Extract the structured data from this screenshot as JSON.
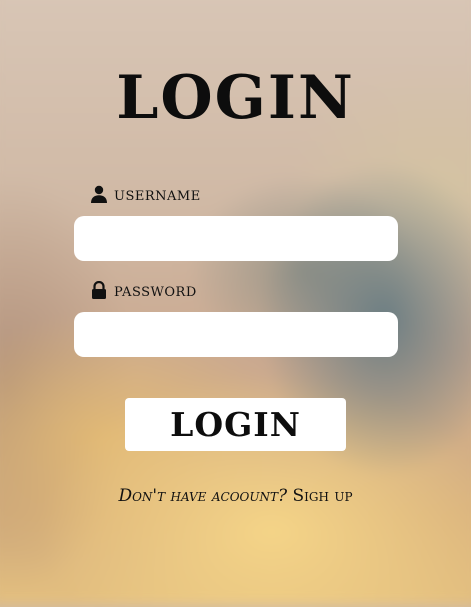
{
  "header": {
    "title": "LOGIN"
  },
  "form": {
    "username": {
      "label": "USERNAME",
      "icon": "user-icon",
      "value": "",
      "placeholder": ""
    },
    "password": {
      "label": "PASSWORD",
      "icon": "lock-icon",
      "value": "",
      "placeholder": ""
    },
    "submit_label": "LOGIN"
  },
  "footer": {
    "prompt": "Don't have acoount?",
    "link_label": "Sigh up"
  },
  "colors": {
    "text": "#0d0d0d",
    "input_bg": "#ffffff",
    "button_bg": "#ffffff"
  }
}
